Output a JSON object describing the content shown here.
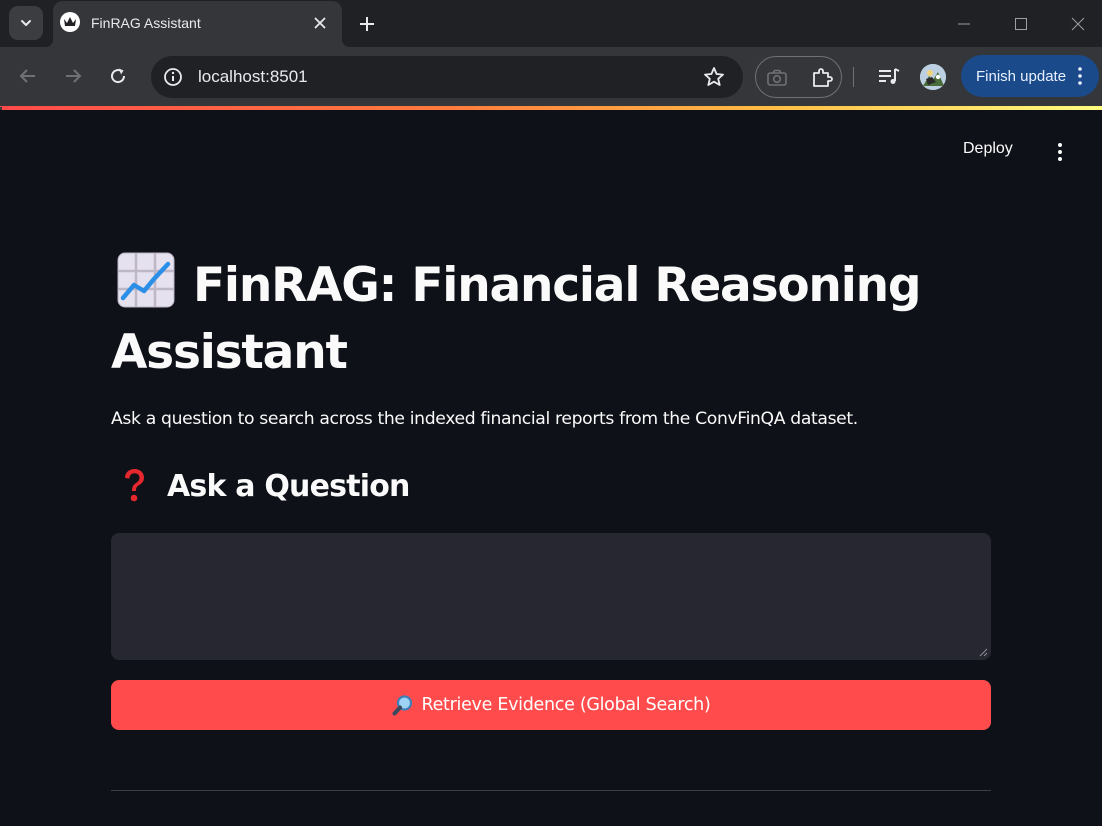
{
  "browser": {
    "tab_title": "FinRAG Assistant",
    "url": "localhost:8501",
    "finish_update_label": "Finish update",
    "icons": {
      "tab_search": "chevron-down-icon",
      "favicon": "crown-icon",
      "close_tab": "close-icon",
      "new_tab": "plus-icon",
      "back": "arrow-left-icon",
      "forward": "arrow-right-icon",
      "reload": "reload-icon",
      "site_info": "info-icon",
      "bookmark": "star-icon",
      "camera": "camera-icon",
      "extensions": "puzzle-icon",
      "media": "media-queue-icon",
      "profile": "avatar",
      "menu": "kebab-icon"
    },
    "accent_colors": [
      "#ff4b4b",
      "#ff7a3d",
      "#ffbd45",
      "#fffd80"
    ]
  },
  "app": {
    "deploy_label": "Deploy",
    "title_emoji": "chart-increasing-icon",
    "title": "FinRAG: Financial Reasoning Assistant",
    "description": "Ask a question to search across the indexed financial reports from the ConvFinQA dataset.",
    "section_emoji": "red-question-mark-icon",
    "section_heading": "Ask a Question",
    "question_input_value": "",
    "retrieve_button_label": "Retrieve Evidence (Global Search)",
    "retrieve_button_icon": "magnifying-glass-icon",
    "colors": {
      "background": "#0e1117",
      "input_background": "#262730",
      "primary": "#ff4b4b",
      "text": "#fafafa"
    }
  }
}
